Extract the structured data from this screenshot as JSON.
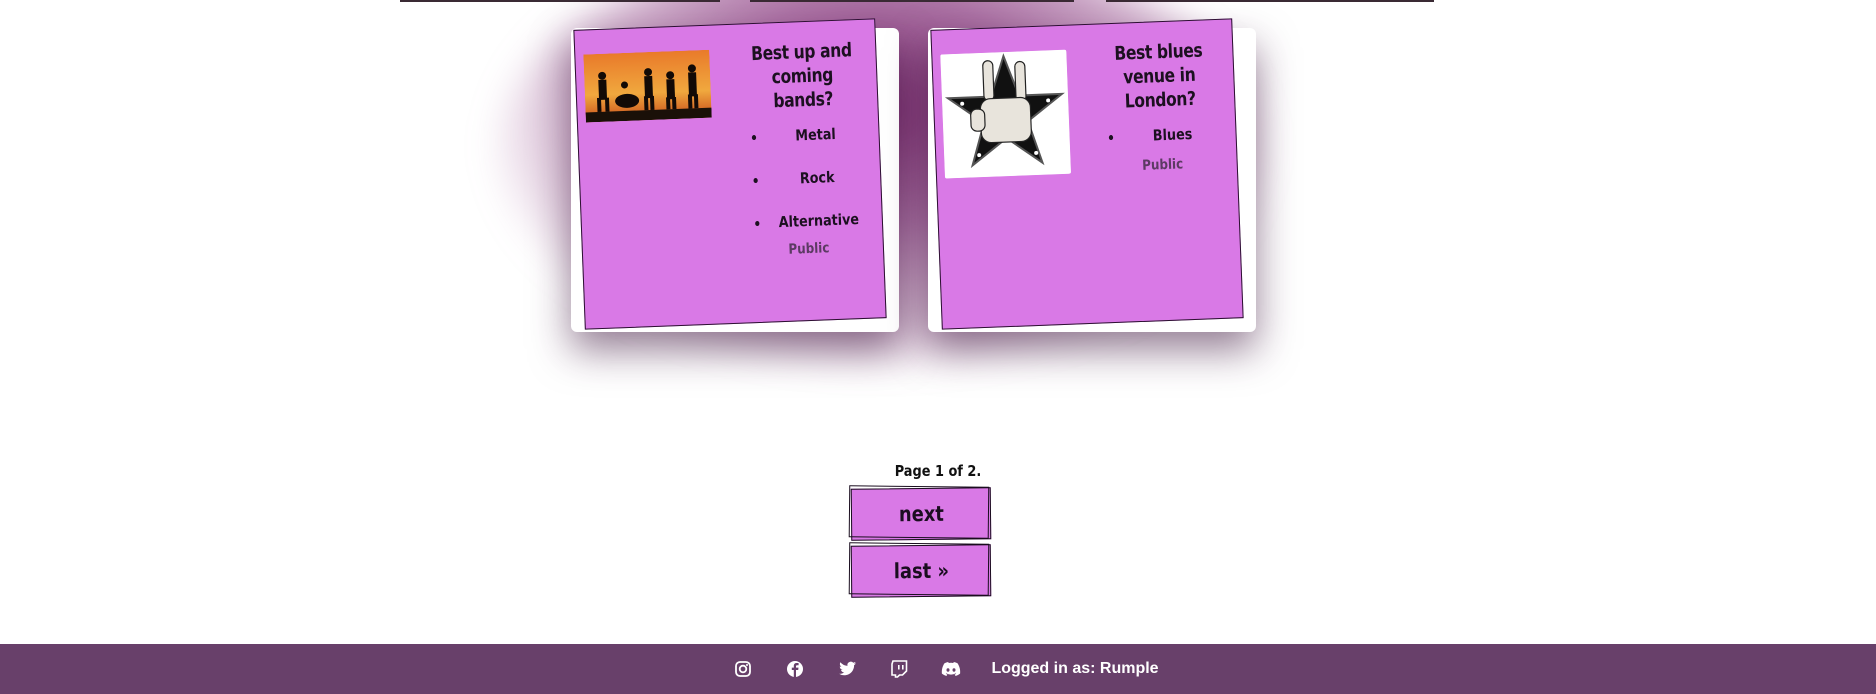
{
  "cards": [
    {
      "title": "Best up and coming bands?",
      "image_alt": "band silhouette at sunset",
      "tags": [
        "Metal",
        "Rock",
        "Alternative"
      ],
      "visibility": "Public"
    },
    {
      "title": "Best blues venue in London?",
      "image_alt": "rock hand star emblem",
      "tags": [
        "Blues"
      ],
      "visibility": "Public"
    }
  ],
  "pagination": {
    "status": "Page 1 of 2.",
    "next_label": "next",
    "last_label": "last »"
  },
  "footer": {
    "icons": [
      "instagram-icon",
      "facebook-icon",
      "twitter-icon",
      "twitch-icon",
      "discord-icon"
    ],
    "logged_in_text": "Logged in as: Rumple"
  },
  "colors": {
    "card": "#d979e6",
    "footer": "#68406a",
    "glow": "#7a286e"
  }
}
